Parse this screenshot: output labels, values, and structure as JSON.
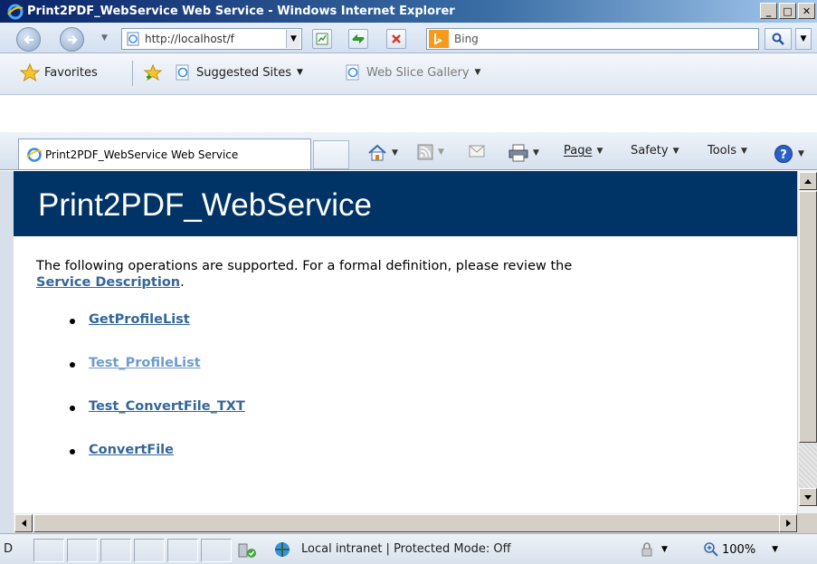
{
  "window": {
    "title": "Print2PDF_WebService Web Service - Windows Internet Explorer",
    "minimize": "_",
    "maximize": "□",
    "close": "✕"
  },
  "address_bar": {
    "url": "http://localhost/f",
    "search_placeholder": "Bing"
  },
  "favorites_bar": {
    "favorites": "Favorites",
    "suggested_sites": "Suggested Sites",
    "web_slice_gallery": "Web Slice Gallery"
  },
  "tab": {
    "label": "Print2PDF_WebService Web Service"
  },
  "command_bar": {
    "page": "Page",
    "safety": "Safety",
    "tools": "Tools"
  },
  "page": {
    "heading": "Print2PDF_WebService",
    "intro_text": "The following operations are supported. For a formal definition, please review the",
    "service_description_link": "Service Description",
    "intro_suffix": ".",
    "operations": [
      {
        "label": "GetProfileList",
        "visited": false
      },
      {
        "label": "Test_ProfileList",
        "visited": true
      },
      {
        "label": "Test_ConvertFile_TXT",
        "visited": false
      },
      {
        "label": "ConvertFile",
        "visited": false
      }
    ]
  },
  "status_bar": {
    "first_cell": "D",
    "zone": "Local intranet | Protected Mode: Off",
    "zoom": "100%"
  },
  "colors": {
    "banner_bg": "#003366",
    "link": "#336699",
    "visited_link": "#6d9ccc"
  }
}
